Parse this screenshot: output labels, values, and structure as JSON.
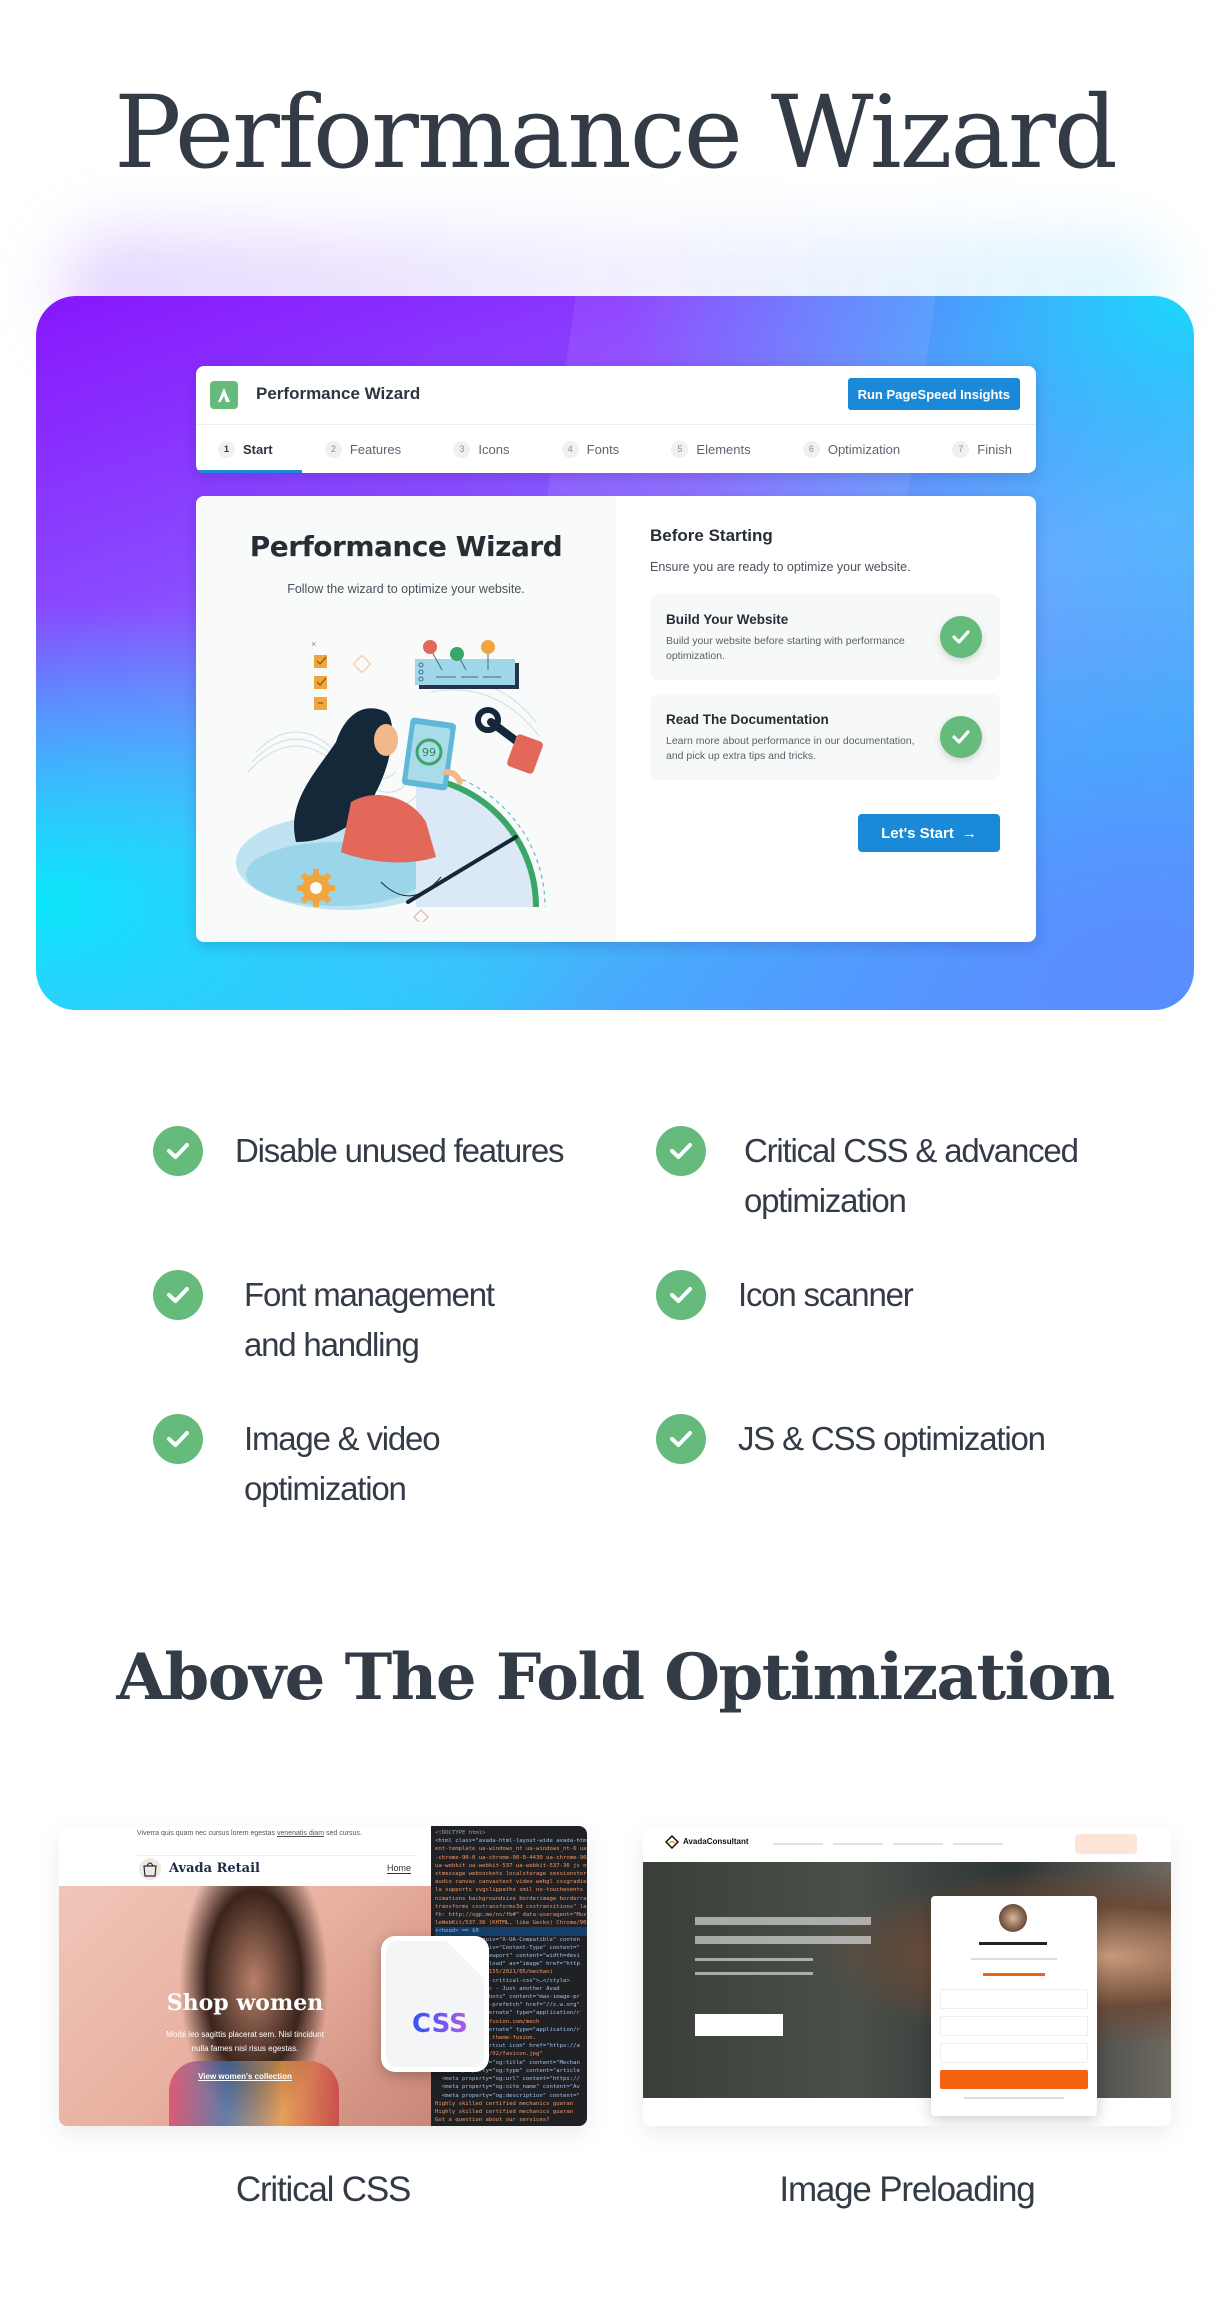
{
  "page": {
    "title": "Performance Wizard",
    "section_title": "Above The Fold Optimization"
  },
  "wizard": {
    "app_title": "Performance Wizard",
    "logo_icon": "avada-logo-icon",
    "psi_button": "Run PageSpeed Insights",
    "steps": [
      {
        "num": "1",
        "label": "Start",
        "active": true
      },
      {
        "num": "2",
        "label": "Features",
        "active": false
      },
      {
        "num": "3",
        "label": "Icons",
        "active": false
      },
      {
        "num": "4",
        "label": "Fonts",
        "active": false
      },
      {
        "num": "5",
        "label": "Elements",
        "active": false
      },
      {
        "num": "6",
        "label": "Optimization",
        "active": false
      },
      {
        "num": "7",
        "label": "Finish",
        "active": false
      }
    ],
    "panel_title": "Performance Wizard",
    "panel_subtitle": "Follow the wizard to optimize your website.",
    "illustration_score": "99",
    "before_title": "Before Starting",
    "before_subtitle": "Ensure you are ready to optimize your website.",
    "checklist": [
      {
        "title": "Build Your Website",
        "desc": "Build your website before starting with performance optimization."
      },
      {
        "title": "Read The Documentation",
        "desc": "Learn more about performance in our documentation, and pick up extra tips and tricks."
      }
    ],
    "start_button": "Let's Start",
    "start_arrow": "→"
  },
  "features": [
    {
      "line1": "Disable unused features",
      "line2": ""
    },
    {
      "line1": "Critical CSS & advanced",
      "line2": "optimization"
    },
    {
      "line1": "Font management",
      "line2": "and handling"
    },
    {
      "line1": "Icon scanner",
      "line2": ""
    },
    {
      "line1": "Image & video",
      "line2": "optimization"
    },
    {
      "line1": "JS & CSS optimization",
      "line2": ""
    }
  ],
  "showcase": {
    "critical_css": {
      "caption": "Critical CSS",
      "topbar_text": "Viverra quis quam nec cursus lorem egestas",
      "topbar_link": "venenatis diam",
      "topbar_end": "sed cursus.",
      "brand": "Avada Retail",
      "nav_home": "Home",
      "hero_title": "Shop women",
      "hero_text_1": "Morbi leo sagittis placerat sem. Nisl tincidunt",
      "hero_text_2": "nulla fames nisl risus egestas.",
      "hero_link": "View women's collection",
      "css_badge": "CSS",
      "code_lines": [
        "<!DOCTYPE html>",
        "<html class=\"avada-html-layout-wide avada-htm",
        "ent-template ua-windows_nt ua-windows_nt-6 ua-w",
        "-chrome-90-0 ua-chrome-90-0-4430 ua-chrome-90-0",
        "ua-webkit ua-webkit-537 ua-webkit-537-36 js no-",
        "stmessage websockets localstorage sessionstorag",
        "audio canvas canvastext video webgl cssgradient",
        "la supports svgclippaths smil no-touchevents fo",
        "nimations backgroundsize borderimage borderradi",
        "transforms csstransforms3d csstransitions\" lang",
        "fb: http://ogp.me/ns/fb#\" data-useragent=\"Mozil",
        "leWebKit/537.36 (KHTML, like Gecko) Chrome/90.0",
        "▾<head> == $0",
        "  <meta http-equiv=\"X-UA-Compatible\" conten",
        "  <meta http-equiv=\"Content-Type\" content=\"",
        "  <meta name=\"viewport\" content=\"width=devi",
        "  <link rel=\"preload\" as=\"image\" href=\"http",
        "  uploads/sites/155/2021/05/mechani",
        "  <style id=\"awb-critical-css\">…</style>",
        "  <title>Mechanic - Just another Avad",
        "  <meta name=\"robots\" content=\"max-image-pr",
        "  <link rel=\"dns-prefetch\" href=\"//s.w.org\"",
        "  <link rel=\"alternate\" type=\"application/r",
        "  //avada.theme-fusion.com/mech",
        "  <link rel=\"alternate\" type=\"application/r",
        "  \"https://avada.theme-fusion.",
        "  <link rel=\"shortcut icon\" href=\"https://a",
        "  sites/155/2021/02/favicon.jpg\"",
        "  <meta property=\"og:title\" content=\"Mechan",
        "  <meta property=\"og:type\" content=\"article",
        "  <meta property=\"og:url\" content=\"https://",
        "  <meta property=\"og:site_name\" content=\"Av",
        "  <meta property=\"og:description\" content=\"",
        "Highly skilled certified mechanics guaran",
        "Highly skilled certified mechanics guaran",
        "Got a question about our services?"
      ]
    },
    "image_preloading": {
      "caption": "Image Preloading",
      "brand": "AvadaConsultant"
    }
  },
  "colors": {
    "accent_blue": "#1a8ad8",
    "check_green": "#64bb7b",
    "heading": "#333b47",
    "orange": "#f5620f",
    "hero_purple": "#8716fd",
    "hero_cyan": "#0ae6fb"
  }
}
